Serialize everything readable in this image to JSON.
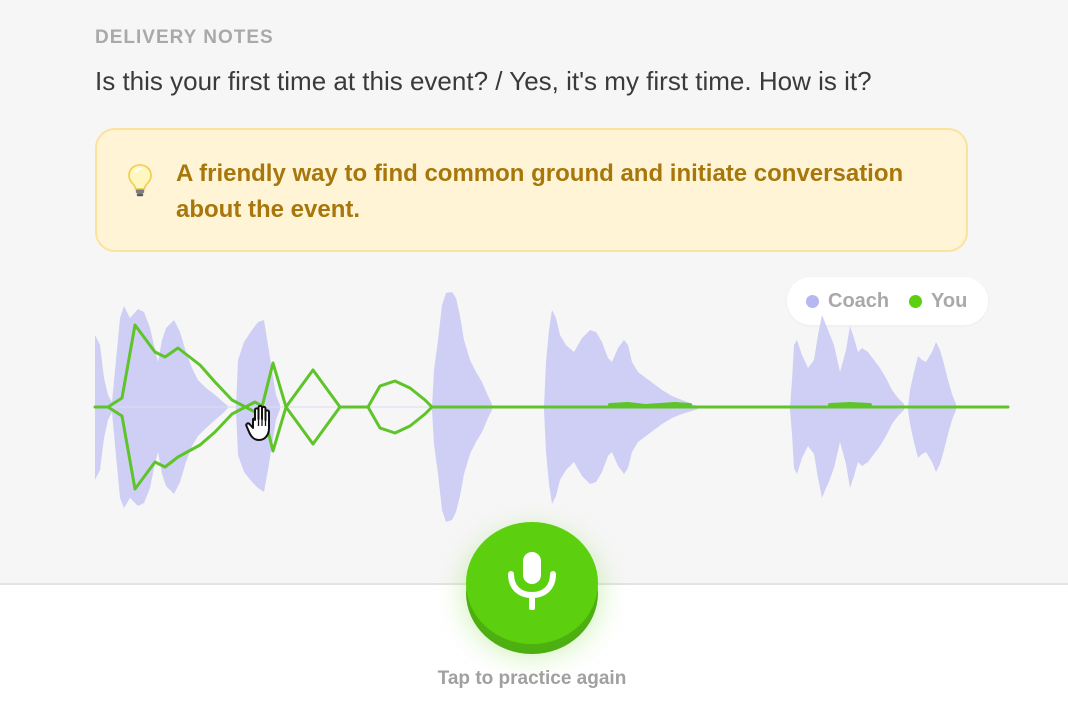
{
  "delivery": {
    "section_label": "DELIVERY NOTES",
    "phrase": "Is this your first time at this event? / Yes, it's my first time. How is it?"
  },
  "tip": {
    "icon": "lightbulb-icon",
    "text": "A friendly way to find common ground and initiate conversation about the event."
  },
  "legend": {
    "items": [
      {
        "label": "Coach",
        "color": "#b7b7f2"
      },
      {
        "label": "You",
        "color": "#5ccf0f"
      }
    ]
  },
  "waveform": {
    "coach_color": "#cfcff5",
    "you_color": "#5ec42a"
  },
  "record": {
    "icon": "microphone-icon",
    "caption": "Tap to practice again",
    "button_color": "#5ccf0f"
  }
}
